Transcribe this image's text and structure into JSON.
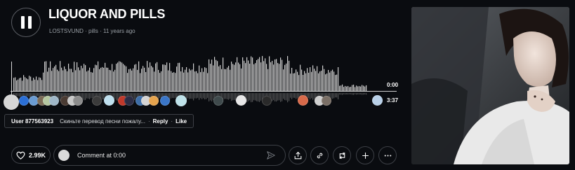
{
  "track": {
    "title": "LIQUOR AND PILLS",
    "artist": "LOSTSVUND",
    "tag": "pills",
    "age": "11 years ago",
    "separator": "·"
  },
  "player": {
    "state": "playing",
    "current_time": "0:00",
    "duration": "3:37"
  },
  "active_comment": {
    "user": "User 877563923",
    "text": "Скиньте перевод песни пожалу...",
    "reply_label": "Reply",
    "like_label": "Like",
    "separator": "·"
  },
  "actions": {
    "like_count": "2.99K",
    "comment_placeholder": "Comment at 0:00"
  },
  "icons": {
    "pause": "pause-icon",
    "heart": "heart-icon",
    "send": "send-icon",
    "share": "share-icon",
    "link": "link-icon",
    "repost": "repost-icon",
    "add": "plus-icon",
    "more": "more-icon"
  },
  "colors": {
    "background": "#0a0c10",
    "waveform": "#d0d0d0",
    "text_muted": "#9aa0a6"
  }
}
